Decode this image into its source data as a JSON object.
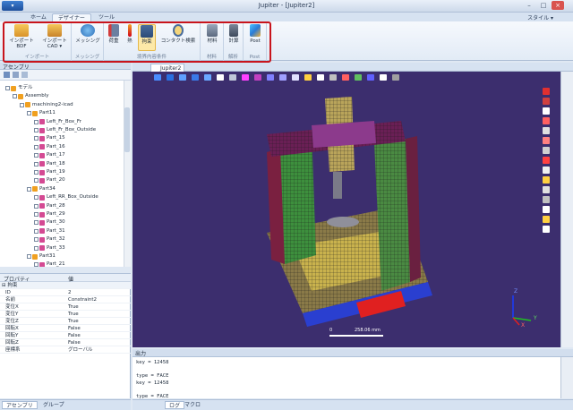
{
  "app": {
    "title": "Jupiter - [Jupiter2]",
    "menu_button": "▾"
  },
  "ribbon": {
    "tabs": [
      {
        "label": "ホーム"
      },
      {
        "label": "デザイナー"
      },
      {
        "label": "ツール"
      }
    ],
    "style_label": "スタイル ▾",
    "groups": [
      {
        "label": "インポート",
        "buttons": [
          {
            "label": "インポートBDF",
            "icon": "folder-open-icon"
          },
          {
            "label": "インポート CAD ▾",
            "icon": "folder-cad-icon"
          }
        ]
      },
      {
        "label": "メッシング",
        "buttons": [
          {
            "label": "メッシング",
            "icon": "globe-mesh-icon"
          }
        ]
      },
      {
        "label": "境界内容条件",
        "buttons": [
          {
            "label": "荷重",
            "icon": "load-arrow-icon"
          },
          {
            "label": "熱",
            "icon": "thermometer-icon"
          },
          {
            "label": "拘束",
            "icon": "constraint-icon"
          },
          {
            "label": "コンタクト検索",
            "icon": "contact-search-icon"
          }
        ]
      },
      {
        "label": "材料",
        "buttons": [
          {
            "label": "材料",
            "icon": "material-icon"
          }
        ]
      },
      {
        "label": "解析",
        "buttons": [
          {
            "label": "計算",
            "icon": "calculate-icon"
          }
        ]
      },
      {
        "label": "Post",
        "buttons": [
          {
            "label": "Post",
            "icon": "post-cube-icon"
          }
        ]
      }
    ]
  },
  "assembly_panel": {
    "title": "アセンブリ",
    "tree": [
      {
        "label": "モデル",
        "level": 0,
        "kind": "asm"
      },
      {
        "label": "Assembly",
        "level": 1,
        "kind": "asm"
      },
      {
        "label": "machining2-icad",
        "level": 2,
        "kind": "asm"
      },
      {
        "label": "Part11",
        "level": 3,
        "kind": "asm"
      },
      {
        "label": "Left_Fr_Box_Fr",
        "level": 4,
        "kind": "part"
      },
      {
        "label": "Left_Fr_Box_Outside",
        "level": 4,
        "kind": "part"
      },
      {
        "label": "Part_15",
        "level": 4,
        "kind": "part"
      },
      {
        "label": "Part_16",
        "level": 4,
        "kind": "part"
      },
      {
        "label": "Part_17",
        "level": 4,
        "kind": "part"
      },
      {
        "label": "Part_18",
        "level": 4,
        "kind": "part"
      },
      {
        "label": "Part_19",
        "level": 4,
        "kind": "part"
      },
      {
        "label": "Part_20",
        "level": 4,
        "kind": "part"
      },
      {
        "label": "Part34",
        "level": 3,
        "kind": "asm"
      },
      {
        "label": "Left_RR_Box_Outside",
        "level": 4,
        "kind": "part"
      },
      {
        "label": "Part_28",
        "level": 4,
        "kind": "part"
      },
      {
        "label": "Part_29",
        "level": 4,
        "kind": "part"
      },
      {
        "label": "Part_30",
        "level": 4,
        "kind": "part"
      },
      {
        "label": "Part_31",
        "level": 4,
        "kind": "part"
      },
      {
        "label": "Part_32",
        "level": 4,
        "kind": "part"
      },
      {
        "label": "Part_33",
        "level": 4,
        "kind": "part"
      },
      {
        "label": "Part31",
        "level": 3,
        "kind": "asm"
      },
      {
        "label": "Part_21",
        "level": 4,
        "kind": "part"
      }
    ]
  },
  "properties": {
    "col_property": "プロパティ",
    "col_value": "値",
    "section": "⊟ 拘束",
    "rows": [
      {
        "key": "ID",
        "value": "2"
      },
      {
        "key": "名前",
        "value": "Constraint2"
      },
      {
        "key": "変位X",
        "value": "True"
      },
      {
        "key": "変位Y",
        "value": "True"
      },
      {
        "key": "変位Z",
        "value": "True"
      },
      {
        "key": "回転X",
        "value": "False"
      },
      {
        "key": "回転Y",
        "value": "False"
      },
      {
        "key": "回転Z",
        "value": "False"
      },
      {
        "key": "座標系",
        "value": "グローバル"
      }
    ]
  },
  "left_bottom_tabs": [
    {
      "label": "アセンブリ"
    },
    {
      "label": "グループ"
    }
  ],
  "document": {
    "tab": "Jupiter2"
  },
  "viewport": {
    "scale_start": "0",
    "scale_end": "258.06 mm",
    "axis_x": "X",
    "axis_y": "Y",
    "axis_z": "Z",
    "background": "#3c2e6e"
  },
  "output": {
    "title": "出力",
    "lines": [
      "key = 12458",
      "",
      "type = FACE",
      "key = 12458",
      "",
      "type = FACE"
    ]
  },
  "output_tabs": [
    {
      "label": "ログ"
    },
    {
      "label": "マクロ"
    }
  ]
}
